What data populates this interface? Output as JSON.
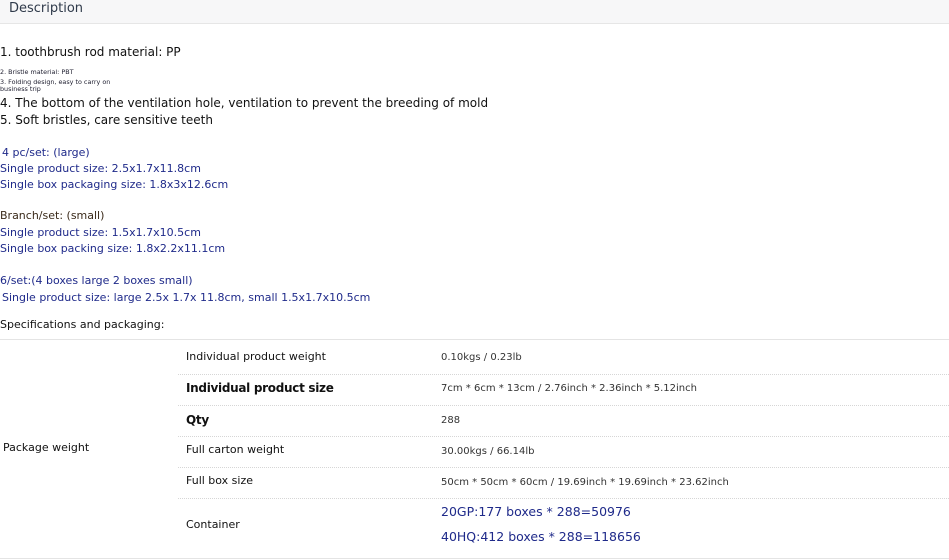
{
  "tab": {
    "label": "Description"
  },
  "features": {
    "line1": "1. toothbrush rod material: PP",
    "line2": "2. Bristle material: PBT",
    "line3a": "3. Folding design, easy to carry on",
    "line3b": "business trip",
    "line4": "4. The bottom of the ventilation hole, ventilation to prevent the breeding of mold",
    "line5": "5. Soft bristles, care sensitive teeth"
  },
  "set_large": {
    "title": "4 pc/set: (large)",
    "product_size": "Single product size: 2.5x1.7x11.8cm",
    "box_size": "Single box packaging size: 1.8x3x12.6cm"
  },
  "set_small": {
    "title": "Branch/set: (small)",
    "product_size": "Single product size: 1.5x1.7x10.5cm",
    "box_size": "Single box packing size: 1.8x2.2x11.1cm"
  },
  "set_mixed": {
    "title": "6/set:(4 boxes large 2 boxes small)",
    "product_size": "Single product size: large 2.5x 1.7x 11.8cm, small 1.5x1.7x10.5cm"
  },
  "specs": {
    "heading": "Specifications and packaging:",
    "group_label": "Package weight",
    "rows": [
      {
        "label": "Individual product weight",
        "value": "0.10kgs / 0.23lb"
      },
      {
        "label": "Individual product size",
        "value": "7cm * 6cm * 13cm / 2.76inch * 2.36inch * 5.12inch"
      },
      {
        "label": "Qty",
        "value": "288"
      },
      {
        "label": "Full carton weight",
        "value": "30.00kgs / 66.14lb"
      },
      {
        "label": "Full box size",
        "value": "50cm * 50cm * 60cm / 19.69inch * 19.69inch * 23.62inch"
      }
    ],
    "container": {
      "label": "Container",
      "line1": "20GP:177 boxes * 288=50976",
      "line2": "40HQ:412 boxes * 288=118656"
    }
  }
}
